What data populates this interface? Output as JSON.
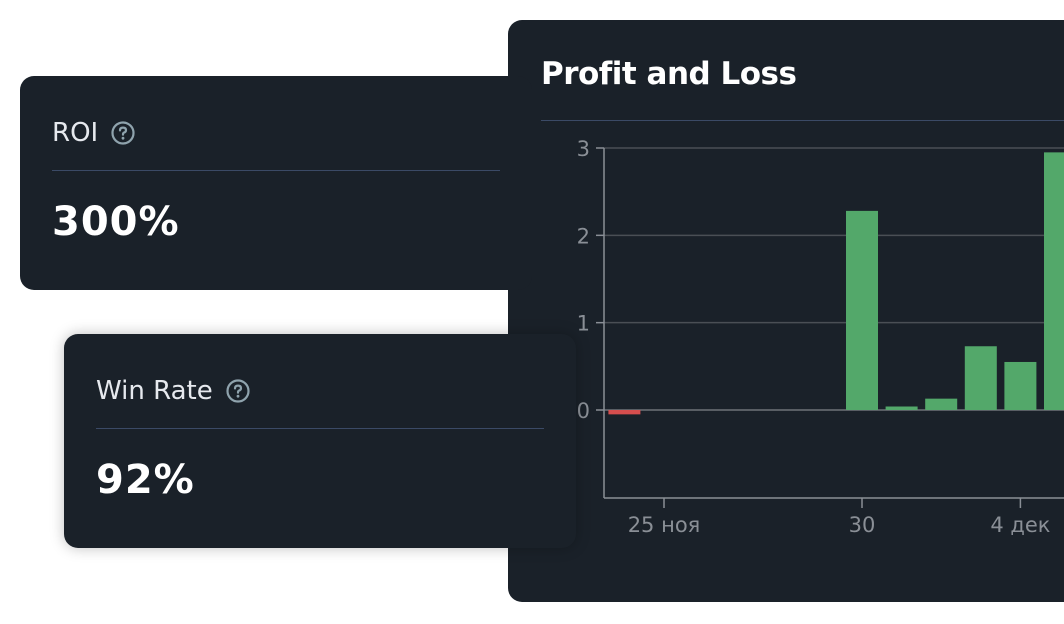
{
  "roi_card": {
    "label": "ROI",
    "value": "300%",
    "help_icon": "question-circle-icon"
  },
  "win_rate_card": {
    "label": "Win Rate",
    "value": "92%",
    "help_icon": "question-circle-icon"
  },
  "chart_card": {
    "title": "Profit and Loss"
  },
  "colors": {
    "card_background": "#1a2129",
    "positive_bar": "#53a86a",
    "negative_bar": "#d64e4e",
    "divider": "#3b4a66",
    "axis": "#8a8f96",
    "tick_text": "#8a8f96"
  },
  "chart_data": {
    "type": "bar",
    "title": "Profit and Loss",
    "xlabel": "",
    "ylabel": "",
    "ylim": [
      -1,
      3
    ],
    "yticks": [
      0,
      1,
      2,
      3
    ],
    "grid": true,
    "x_tick_labels": [
      {
        "date": "2024-11-25",
        "label": "25 ноя"
      },
      {
        "date": "2024-11-30",
        "label": "30"
      },
      {
        "date": "2024-12-04",
        "label": "4 дек"
      }
    ],
    "series": [
      {
        "points": [
          {
            "date": "2024-11-24",
            "value": -0.05
          },
          {
            "date": "2024-11-30",
            "value": 2.28
          },
          {
            "date": "2024-12-01",
            "value": 0.04
          },
          {
            "date": "2024-12-02",
            "value": 0.13
          },
          {
            "date": "2024-12-03",
            "value": 0.73
          },
          {
            "date": "2024-12-04",
            "value": 0.55
          },
          {
            "date": "2024-12-05",
            "value": 2.95
          }
        ]
      }
    ]
  }
}
